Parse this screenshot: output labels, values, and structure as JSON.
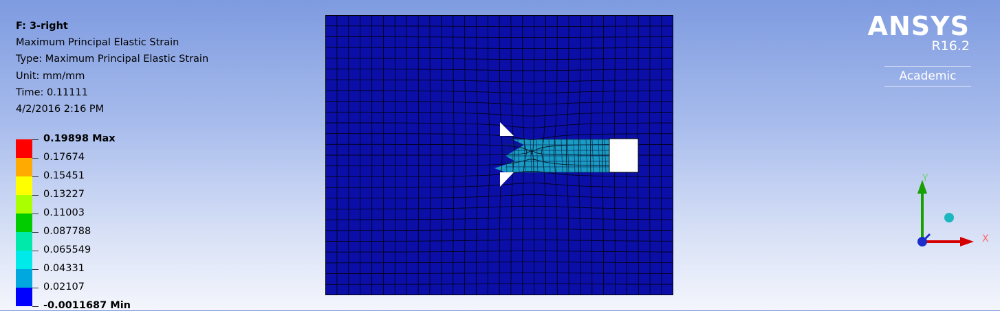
{
  "info": {
    "title": "F: 3-right",
    "result": "Maximum Principal Elastic Strain",
    "type": "Type: Maximum Principal Elastic Strain",
    "unit": "Unit: mm/mm",
    "time": "Time: 0.11111",
    "date": "4/2/2016 2:16 PM"
  },
  "legend": {
    "labels": [
      "0.19898 Max",
      "0.17674",
      "0.15451",
      "0.13227",
      "0.11003",
      "0.087788",
      "0.065549",
      "0.04331",
      "0.02107",
      "-0.0011687 Min"
    ],
    "colors": [
      "#ff0000",
      "#ffaa00",
      "#ffff00",
      "#aaff00",
      "#00cc00",
      "#00e8aa",
      "#00eaea",
      "#00a8e0",
      "#0000ff"
    ]
  },
  "logo": {
    "name": "ANSYS",
    "version": "R16.2",
    "edition": "Academic"
  },
  "triad": {
    "x_label": "X",
    "y_label": "Y"
  },
  "colors": {
    "mesh_fill": "#0b0fa8",
    "crack_zone": "#1a9bc4",
    "mesh_line": "#000000"
  }
}
